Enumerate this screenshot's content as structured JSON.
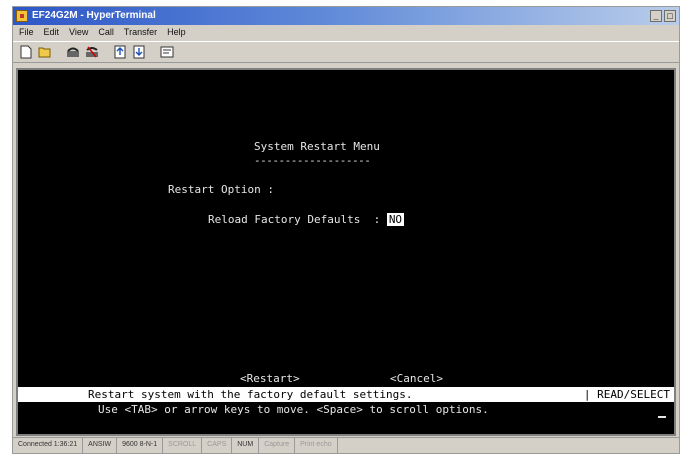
{
  "window": {
    "title": "EF24G2M - HyperTerminal"
  },
  "menu": [
    {
      "label": "File"
    },
    {
      "label": "Edit"
    },
    {
      "label": "View"
    },
    {
      "label": "Call"
    },
    {
      "label": "Transfer"
    },
    {
      "label": "Help"
    }
  ],
  "toolbar": [
    {
      "icon": "new-document-icon"
    },
    {
      "icon": "open-folder-icon"
    },
    {
      "icon": "phone-connect-icon"
    },
    {
      "icon": "phone-disconnect-icon"
    },
    {
      "icon": "send-icon"
    },
    {
      "icon": "receive-icon"
    },
    {
      "icon": "properties-icon"
    }
  ],
  "terminal": {
    "title": "System Restart Menu",
    "underline": "-------------------",
    "restart_option_label": "Restart Option :",
    "reload_label": "Reload Factory Defaults  : ",
    "reload_value": "NO",
    "restart_button": "<Restart>",
    "cancel_button": "<Cancel>",
    "status_message": "Restart system with the factory default settings.",
    "status_mode": "| READ/SELECT",
    "help_text": "Use <TAB> or arrow keys to move. <Space> to scroll options."
  },
  "statusbar": {
    "connected": "Connected 1:36:21",
    "emulation": "ANSIW",
    "settings": "9600 8-N-1",
    "scroll": "SCROLL",
    "caps": "CAPS",
    "num": "NUM",
    "capture": "Capture",
    "print_echo": "Print echo"
  },
  "colors": {
    "terminal_bg": "#000000",
    "terminal_fg": "#e6e6e6",
    "titlebar": "#2e56c7",
    "chrome": "#d4d0c8"
  }
}
